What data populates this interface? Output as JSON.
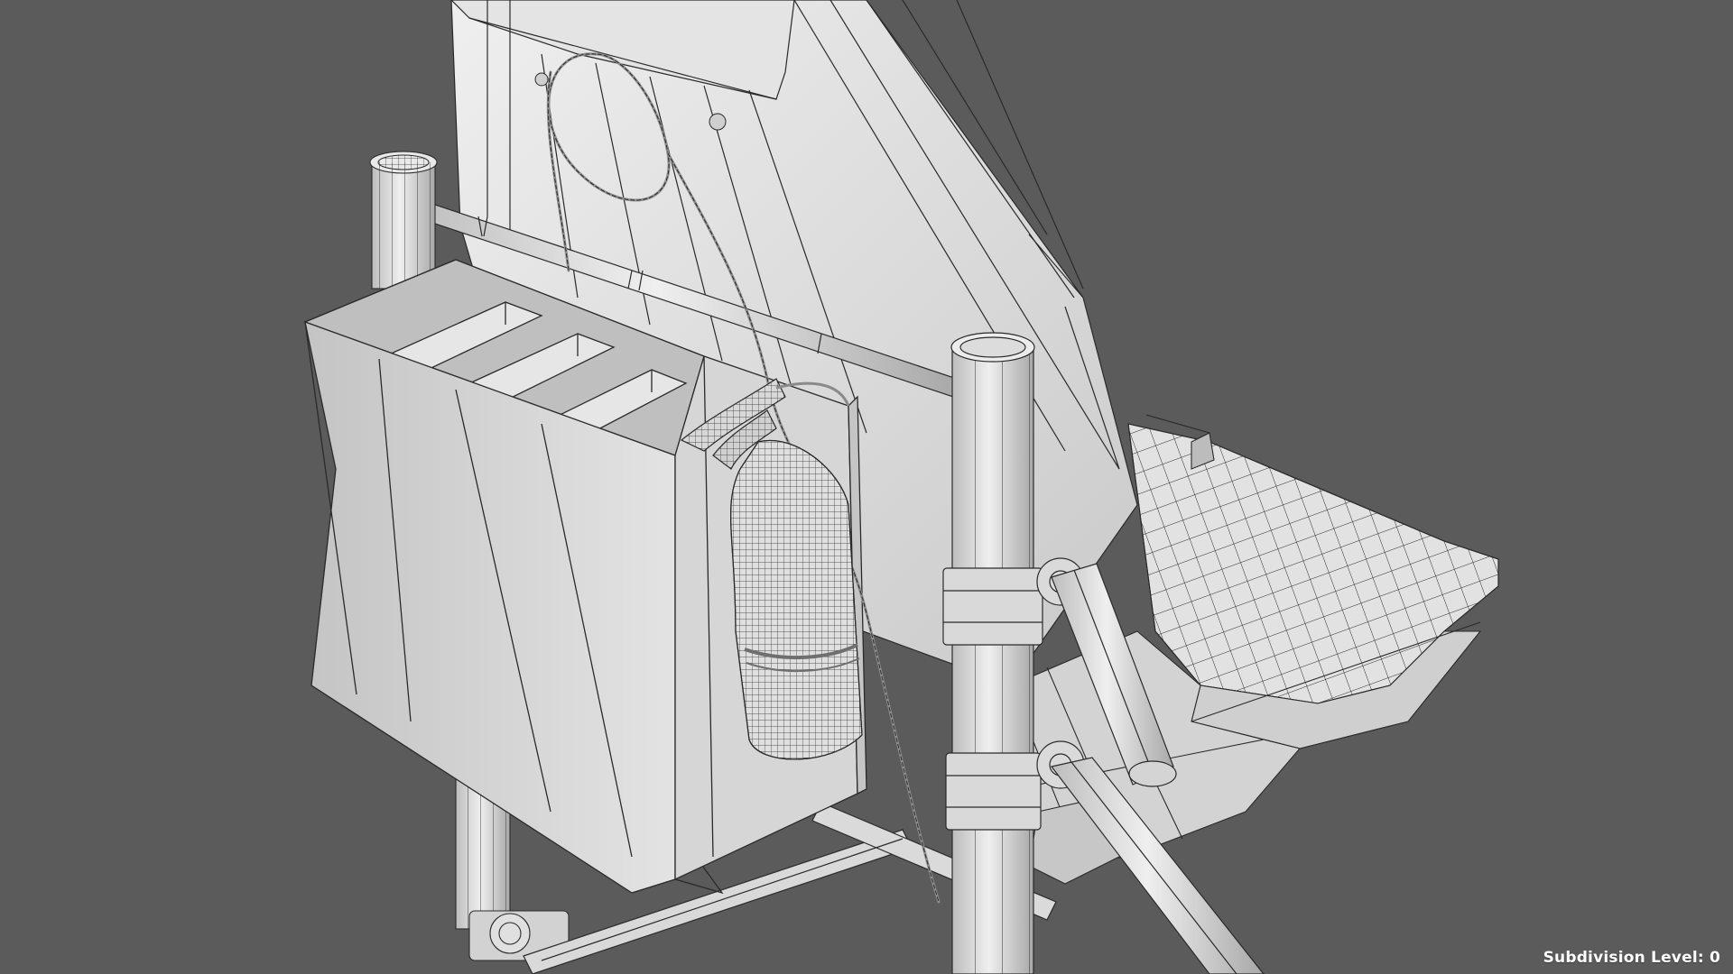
{
  "viewport": {
    "background_color": "#5b5b5b",
    "mesh_color": "#dcdcdc",
    "wire_color": "#2a2a2a"
  },
  "overlay": {
    "subdivision_label": "Subdivision Level: 0"
  }
}
